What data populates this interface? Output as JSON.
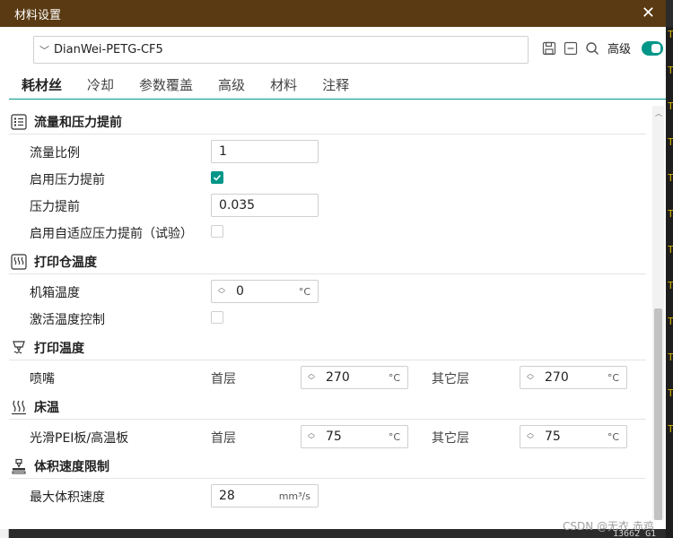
{
  "window": {
    "title": "材料设置",
    "close_glyph": "✕"
  },
  "preset": {
    "chevron": "﹀",
    "name": "DianWei-PETG-CF5"
  },
  "toolbar": {
    "advanced_label": "高级",
    "advanced_on": true
  },
  "tabs": [
    {
      "label": "耗材丝",
      "active": true
    },
    {
      "label": "冷却"
    },
    {
      "label": "参数覆盖"
    },
    {
      "label": "高级"
    },
    {
      "label": "材料"
    },
    {
      "label": "注释"
    }
  ],
  "sections": {
    "flow": {
      "title": "流量和压力提前",
      "icon": "list-icon",
      "flow_ratio": {
        "label": "流量比例",
        "value": "1"
      },
      "enable_pa": {
        "label": "启用压力提前",
        "checked": true
      },
      "pa": {
        "label": "压力提前",
        "value": "0.035"
      },
      "adaptive_pa": {
        "label": "启用自适应压力提前（试验）",
        "checked": false
      }
    },
    "chamber": {
      "title": "打印仓温度",
      "icon": "heat-icon",
      "chamber_temp": {
        "label": "机箱温度",
        "value": "0",
        "unit": "°C"
      },
      "activate": {
        "label": "激活温度控制",
        "checked": false
      }
    },
    "print_temp": {
      "title": "打印温度",
      "icon": "nozzle-icon",
      "nozzle": {
        "label": "喷嘴",
        "first_label": "首层",
        "first_value": "270",
        "other_label": "其它层",
        "other_value": "270",
        "unit": "°C"
      }
    },
    "bed": {
      "title": "床温",
      "icon": "bed-heat-icon",
      "plate": {
        "label": "光滑PEI板/高温板",
        "first_label": "首层",
        "first_value": "75",
        "other_label": "其它层",
        "other_value": "75",
        "unit": "°C"
      }
    },
    "volumetric": {
      "title": "体积速度限制",
      "icon": "volumetric-icon",
      "max_speed": {
        "label": "最大体积速度",
        "value": "28",
        "unit": "mm³/s"
      }
    }
  },
  "spinner": {
    "up": "︿",
    "down": "﹀"
  },
  "watermark": "CSDN @无衣 赤鸡",
  "background": {
    "right_glyphs": [
      "T",
      "T",
      "T",
      "T",
      "T",
      "T",
      "T",
      "T",
      "T",
      "T",
      "T",
      "T"
    ],
    "status_fragment": "13662 G1"
  }
}
